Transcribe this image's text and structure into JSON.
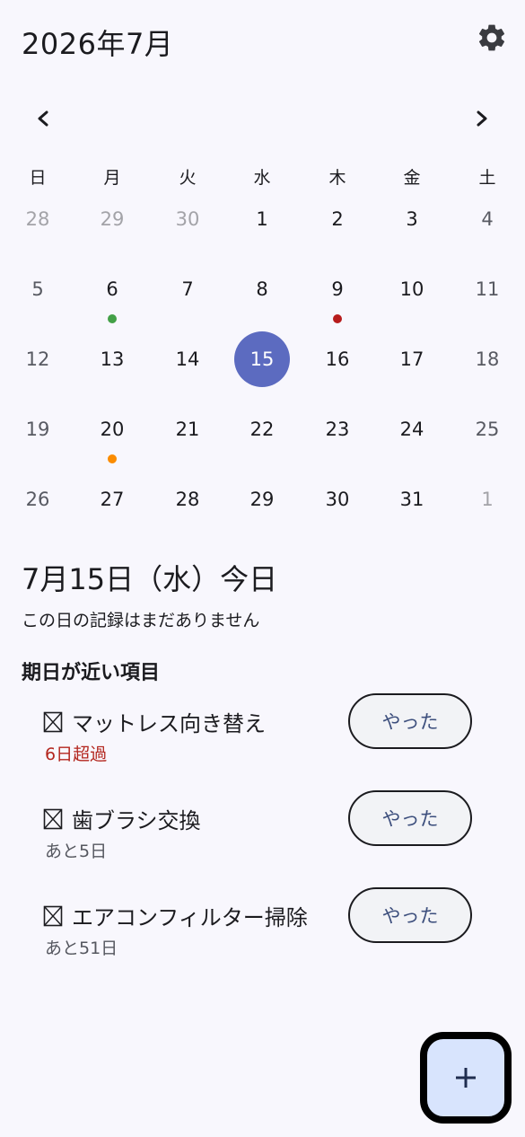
{
  "header": {
    "title": "2026年7月"
  },
  "calendar": {
    "weekdays": [
      "日",
      "月",
      "火",
      "水",
      "木",
      "金",
      "土"
    ],
    "weeks": [
      [
        {
          "d": "28",
          "other": true
        },
        {
          "d": "29",
          "other": true
        },
        {
          "d": "30",
          "other": true
        },
        {
          "d": "1"
        },
        {
          "d": "2"
        },
        {
          "d": "3"
        },
        {
          "d": "4"
        }
      ],
      [
        {
          "d": "5"
        },
        {
          "d": "6",
          "dot": "#43a047"
        },
        {
          "d": "7"
        },
        {
          "d": "8"
        },
        {
          "d": "9",
          "dot": "#b71c1c"
        },
        {
          "d": "10"
        },
        {
          "d": "11"
        }
      ],
      [
        {
          "d": "12"
        },
        {
          "d": "13"
        },
        {
          "d": "14"
        },
        {
          "d": "15",
          "selected": true
        },
        {
          "d": "16"
        },
        {
          "d": "17"
        },
        {
          "d": "18"
        }
      ],
      [
        {
          "d": "19"
        },
        {
          "d": "20",
          "dot": "#fb8c00"
        },
        {
          "d": "21"
        },
        {
          "d": "22"
        },
        {
          "d": "23"
        },
        {
          "d": "24"
        },
        {
          "d": "25"
        }
      ],
      [
        {
          "d": "26"
        },
        {
          "d": "27"
        },
        {
          "d": "28"
        },
        {
          "d": "29"
        },
        {
          "d": "30"
        },
        {
          "d": "31"
        },
        {
          "d": "1",
          "other": true
        }
      ]
    ],
    "selected_color": "#5c6bc0"
  },
  "day_detail": {
    "heading": "7月15日（水）今日",
    "empty_note": "この日の記録はまだありません"
  },
  "upcoming": {
    "title": "期日が近い項目",
    "items": [
      {
        "name": "マットレス向き替え",
        "status": "6日超過",
        "overdue": true,
        "button": "やった"
      },
      {
        "name": "歯ブラシ交換",
        "status": "あと5日",
        "overdue": false,
        "button": "やった"
      },
      {
        "name": "エアコンフィルター掃除",
        "status": "あと51日",
        "overdue": false,
        "button": "やった"
      }
    ]
  },
  "icons": {
    "settings": "gear-icon",
    "prev": "chevron-left-icon",
    "next": "chevron-right-icon",
    "fab": "plus-icon"
  }
}
